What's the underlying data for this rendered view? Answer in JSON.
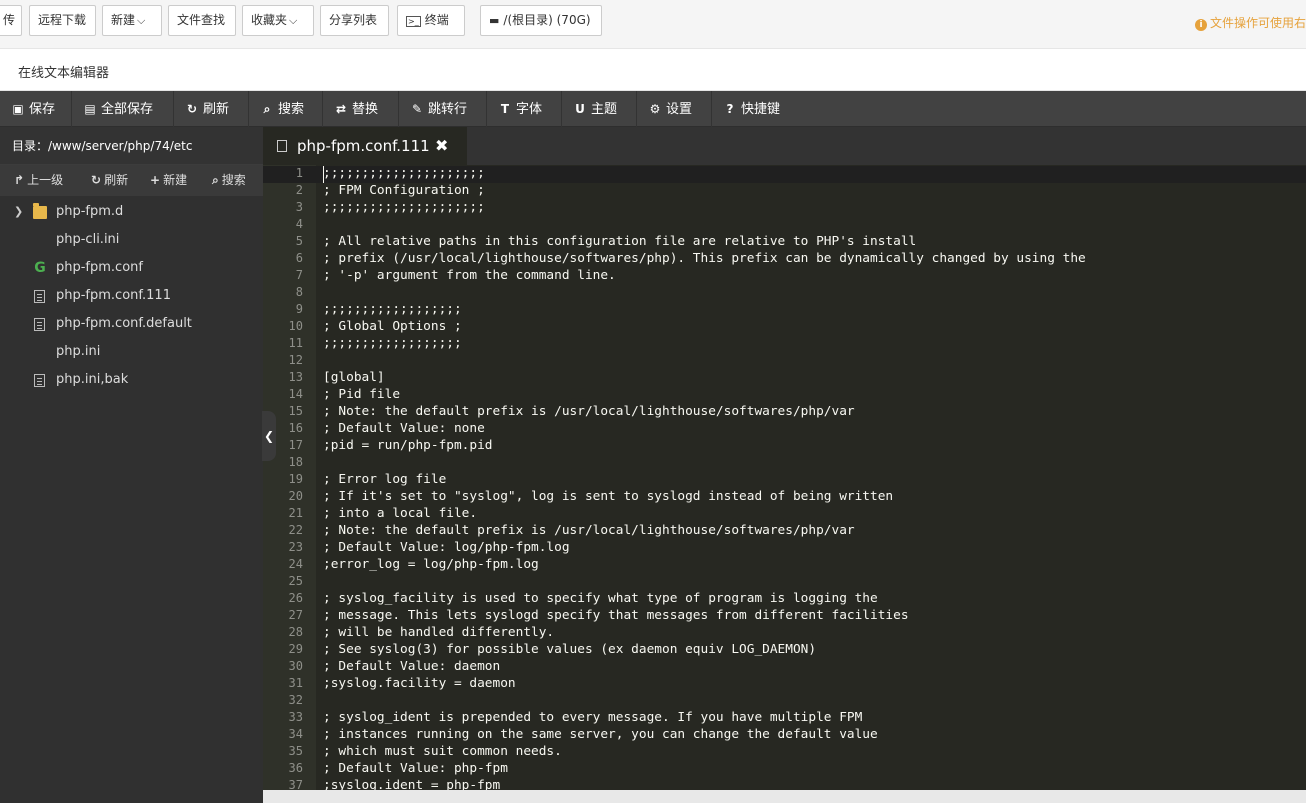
{
  "topbar": {
    "buttons": [
      {
        "label": "传",
        "icon": ""
      },
      {
        "label": "远程下载",
        "icon": ""
      },
      {
        "label": "新建",
        "icon": "chevron-down-icon"
      },
      {
        "label": "文件查找",
        "icon": ""
      },
      {
        "label": "收藏夹",
        "icon": "chevron-down-icon"
      },
      {
        "label": "分享列表",
        "icon": ""
      },
      {
        "label": "终端",
        "icon": "terminal-icon"
      },
      {
        "label": "/(根目录) (70G)",
        "icon": "disk-icon"
      }
    ],
    "notice": "文件操作可使用右"
  },
  "title": "在线文本编辑器",
  "toolbar": {
    "items": [
      {
        "label": "保存",
        "icon": "save-icon"
      },
      {
        "label": "全部保存",
        "icon": "save-all-icon"
      },
      {
        "label": "刷新",
        "icon": "refresh-icon"
      },
      {
        "label": "搜索",
        "icon": "search-icon"
      },
      {
        "label": "替换",
        "icon": "replace-icon"
      },
      {
        "label": "跳转行",
        "icon": "pin-icon"
      },
      {
        "label": "字体",
        "icon": "font-icon"
      },
      {
        "label": "主题",
        "icon": "magnet-icon"
      },
      {
        "label": "设置",
        "icon": "gear-icon"
      },
      {
        "label": "快捷键",
        "icon": "question-icon"
      }
    ]
  },
  "sidebar": {
    "dir_label": "目录：/www/server/php/74/etc",
    "actions": [
      {
        "label": "上一级",
        "icon": "share-icon"
      },
      {
        "label": "刷新",
        "icon": "refresh-icon"
      },
      {
        "label": "新建",
        "icon": "plus-icon"
      },
      {
        "label": "搜索",
        "icon": "search-icon"
      }
    ],
    "files": [
      {
        "name": "php-fpm.d",
        "type": "folder"
      },
      {
        "name": "php-cli.ini",
        "type": "none"
      },
      {
        "name": "php-fpm.conf",
        "type": "gear"
      },
      {
        "name": "php-fpm.conf.111",
        "type": "doc"
      },
      {
        "name": "php-fpm.conf.default",
        "type": "doc"
      },
      {
        "name": "php.ini",
        "type": "none"
      },
      {
        "name": "php.ini,bak",
        "type": "doc"
      }
    ]
  },
  "tab": {
    "name": "php-fpm.conf.111",
    "close": "✖"
  },
  "editor": {
    "lines": [
      ";;;;;;;;;;;;;;;;;;;;;",
      "; FPM Configuration ;",
      ";;;;;;;;;;;;;;;;;;;;;",
      "",
      "; All relative paths in this configuration file are relative to PHP's install",
      "; prefix (/usr/local/lighthouse/softwares/php). This prefix can be dynamically changed by using the",
      "; '-p' argument from the command line.",
      "",
      ";;;;;;;;;;;;;;;;;;",
      "; Global Options ;",
      ";;;;;;;;;;;;;;;;;;",
      "",
      "[global]",
      "; Pid file",
      "; Note: the default prefix is /usr/local/lighthouse/softwares/php/var",
      "; Default Value: none",
      ";pid = run/php-fpm.pid",
      "",
      "; Error log file",
      "; If it's set to \"syslog\", log is sent to syslogd instead of being written",
      "; into a local file.",
      "; Note: the default prefix is /usr/local/lighthouse/softwares/php/var",
      "; Default Value: log/php-fpm.log",
      ";error_log = log/php-fpm.log",
      "",
      "; syslog_facility is used to specify what type of program is logging the",
      "; message. This lets syslogd specify that messages from different facilities",
      "; will be handled differently.",
      "; See syslog(3) for possible values (ex daemon equiv LOG_DAEMON)",
      "; Default Value: daemon",
      ";syslog.facility = daemon",
      "",
      "; syslog_ident is prepended to every message. If you have multiple FPM",
      "; instances running on the same server, you can change the default value",
      "; which must suit common needs.",
      "; Default Value: php-fpm",
      ";syslog.ident = php-fpm"
    ]
  },
  "colors": {
    "editor_bg": "#272822",
    "toolbar_bg": "#424242",
    "sidebar_bg": "#303030",
    "notice": "#e6a23c"
  }
}
